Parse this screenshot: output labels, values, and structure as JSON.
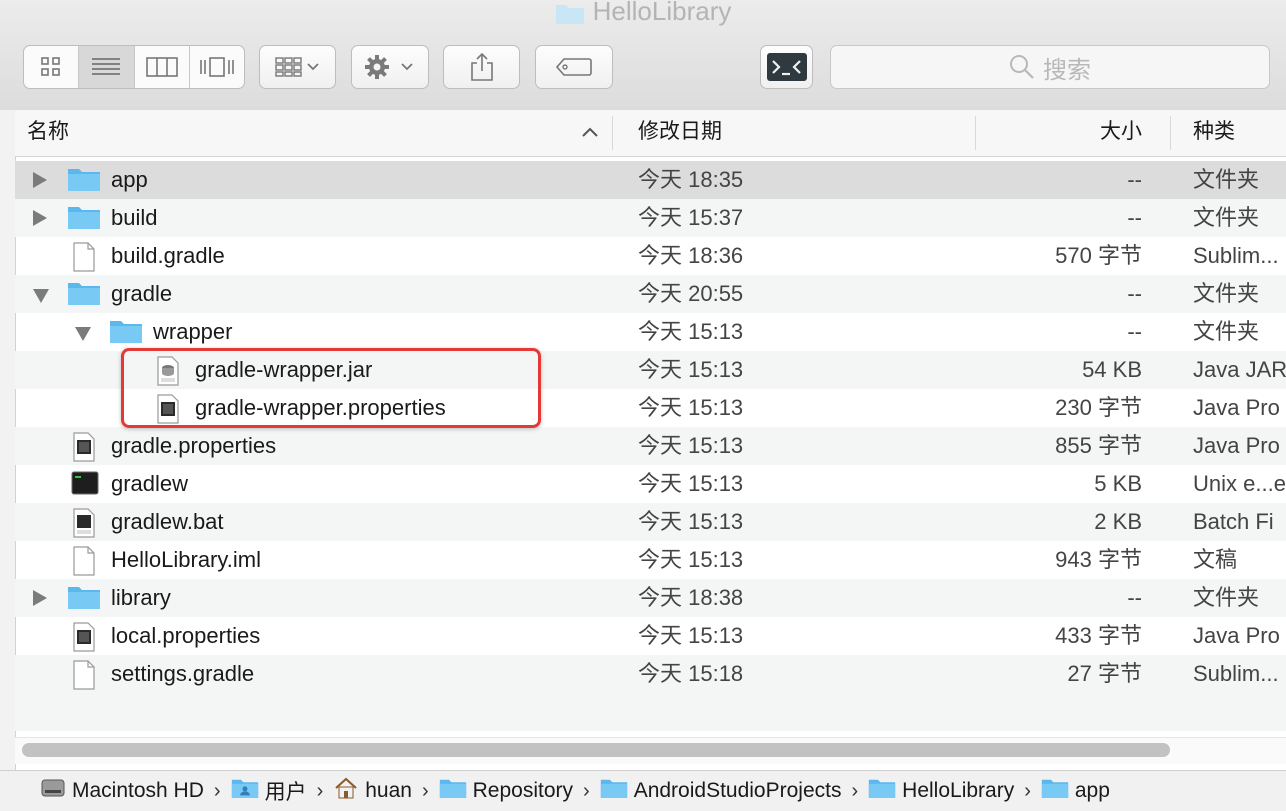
{
  "window": {
    "title": "HelloLibrary"
  },
  "search": {
    "placeholder": "搜索"
  },
  "columns": {
    "name": "名称",
    "date": "修改日期",
    "size": "大小",
    "kind": "种类"
  },
  "colors": {
    "folder": "#6cc3f3",
    "highlight": "#e53935",
    "selected_row": "#dcdcdc"
  },
  "rows": [
    {
      "name": "app",
      "date": "今天 18:35",
      "size": "--",
      "kind": "文件夹",
      "icon": "folder-icon",
      "disclosure": "collapsed",
      "indent": 0
    },
    {
      "name": "build",
      "date": "今天 15:37",
      "size": "--",
      "kind": "文件夹",
      "icon": "folder-icon",
      "disclosure": "collapsed",
      "indent": 0
    },
    {
      "name": "build.gradle",
      "date": "今天 18:36",
      "size": "570 字节",
      "kind": "Sublim...",
      "icon": "document-icon",
      "disclosure": "none",
      "indent": 0
    },
    {
      "name": "gradle",
      "date": "今天 20:55",
      "size": "--",
      "kind": "文件夹",
      "icon": "folder-icon",
      "disclosure": "expanded",
      "indent": 0
    },
    {
      "name": "wrapper",
      "date": "今天 15:13",
      "size": "--",
      "kind": "文件夹",
      "icon": "folder-icon",
      "disclosure": "expanded",
      "indent": 1
    },
    {
      "name": "gradle-wrapper.jar",
      "date": "今天 15:13",
      "size": "54 KB",
      "kind": "Java JAR",
      "icon": "jar-file-icon",
      "disclosure": "none",
      "indent": 2
    },
    {
      "name": "gradle-wrapper.properties",
      "date": "今天 15:13",
      "size": "230 字节",
      "kind": "Java Pro",
      "icon": "java-file-icon",
      "disclosure": "none",
      "indent": 2
    },
    {
      "name": "gradle.properties",
      "date": "今天 15:13",
      "size": "855 字节",
      "kind": "Java Pro",
      "icon": "java-file-icon",
      "disclosure": "none",
      "indent": 0
    },
    {
      "name": "gradlew",
      "date": "今天 15:13",
      "size": "5 KB",
      "kind": "Unix e...e",
      "icon": "terminal-icon",
      "disclosure": "none",
      "indent": 0
    },
    {
      "name": "gradlew.bat",
      "date": "今天 15:13",
      "size": "2 KB",
      "kind": "Batch Fi",
      "icon": "batch-file-icon",
      "disclosure": "none",
      "indent": 0
    },
    {
      "name": "HelloLibrary.iml",
      "date": "今天 15:13",
      "size": "943 字节",
      "kind": "文稿",
      "icon": "document-icon",
      "disclosure": "none",
      "indent": 0
    },
    {
      "name": "library",
      "date": "今天 18:38",
      "size": "--",
      "kind": "文件夹",
      "icon": "folder-icon",
      "disclosure": "collapsed",
      "indent": 0
    },
    {
      "name": "local.properties",
      "date": "今天 15:13",
      "size": "433 字节",
      "kind": "Java Pro",
      "icon": "java-file-icon",
      "disclosure": "none",
      "indent": 0
    },
    {
      "name": "settings.gradle",
      "date": "今天 15:18",
      "size": "27 字节",
      "kind": "Sublim...",
      "icon": "document-icon",
      "disclosure": "none",
      "indent": 0
    }
  ],
  "path": [
    {
      "label": "Macintosh HD",
      "icon": "hard-drive-icon"
    },
    {
      "label": "用户",
      "icon": "users-folder-icon"
    },
    {
      "label": "huan",
      "icon": "home-icon"
    },
    {
      "label": "Repository",
      "icon": "folder-icon"
    },
    {
      "label": "AndroidStudioProjects",
      "icon": "folder-icon"
    },
    {
      "label": "HelloLibrary",
      "icon": "folder-icon"
    },
    {
      "label": "app",
      "icon": "folder-icon"
    }
  ]
}
